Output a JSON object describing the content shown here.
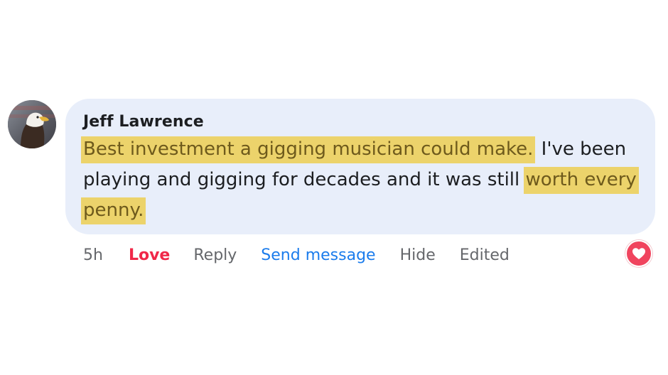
{
  "comment": {
    "author": "Jeff Lawrence",
    "avatar_icon": "eagle-avatar",
    "segments": [
      {
        "text": "Best investment a gigging musician could make.",
        "highlighted": true
      },
      {
        "text": " I've been playing and gigging for decades and it was still ",
        "highlighted": false
      },
      {
        "text": "worth every penny.",
        "highlighted": true
      }
    ],
    "highlight_color": "#ecd36b",
    "bubble_color": "#e8eefa"
  },
  "actions": {
    "time": "5h",
    "love": "Love",
    "reply": "Reply",
    "send_message": "Send message",
    "hide": "Hide",
    "edited": "Edited"
  },
  "reaction": {
    "icon": "heart-icon",
    "color": "#f0445e"
  }
}
